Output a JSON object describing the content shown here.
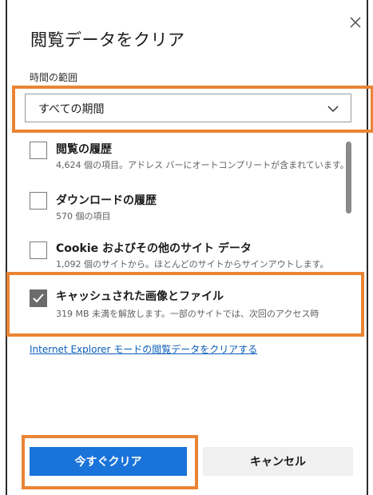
{
  "dialog": {
    "title": "閲覧データをクリア",
    "close_icon": "close-icon"
  },
  "time_range": {
    "label": "時間の範囲",
    "selected": "すべての期間"
  },
  "items": [
    {
      "title": "閲覧の履歴",
      "description": "4,624 個の項目。アドレス バーにオートコンプリートが含まれています。",
      "checked": false
    },
    {
      "title": "ダウンロードの履歴",
      "description": "570 個の項目",
      "checked": false
    },
    {
      "title": "Cookie およびその他のサイト データ",
      "description": "1,092 個のサイトから。ほとんどのサイトからサインアウトします。",
      "checked": false
    },
    {
      "title": "キャッシュされた画像とファイル",
      "description": "319 MB 未満を解放します。一部のサイトでは、次回のアクセス時",
      "checked": true
    }
  ],
  "ie_link": "Internet Explorer モードの閲覧データをクリアする",
  "buttons": {
    "clear_now": "今すぐクリア",
    "cancel": "キャンセル"
  },
  "colors": {
    "highlight": "#ea8434",
    "primary": "#1a73d9",
    "link": "#0a5eb8"
  }
}
